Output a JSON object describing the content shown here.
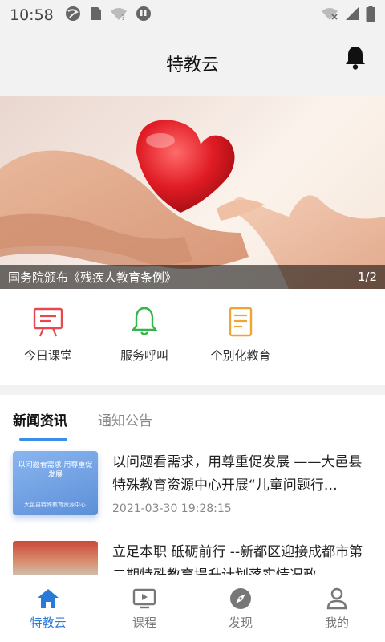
{
  "status_bar": {
    "time": "10:58",
    "icons_left": [
      "globe-icon",
      "sim-card-icon",
      "wifi-question-icon",
      "app-notification-icon"
    ],
    "icons_right": [
      "wifi-off-icon",
      "signal-icon",
      "battery-icon"
    ]
  },
  "header": {
    "title": "特教云",
    "action_icon": "bell-icon"
  },
  "banner": {
    "caption": "国务院颁布《残疾人教育条例》",
    "pager": "1/2"
  },
  "quick_actions": [
    {
      "label": "今日课堂",
      "icon": "presentation-board-icon",
      "color": "#e5484d"
    },
    {
      "label": "服务呼叫",
      "icon": "bell-outline-icon",
      "color": "#35b44a"
    },
    {
      "label": "个别化教育",
      "icon": "document-icon",
      "color": "#f0a531"
    }
  ],
  "news_tabs": [
    {
      "label": "新闻资讯",
      "active": true
    },
    {
      "label": "通知公告",
      "active": false
    }
  ],
  "news": [
    {
      "title": "以问题看需求，用尊重促发展 ——大邑县特殊教育资源中心开展“儿童问题行…",
      "time": "2021-03-30 19:28:15",
      "thumb_text": "以问题看需求 用尊重促发展",
      "thumb_subtext": "大邑县特殊教育资源中心"
    },
    {
      "title": "立足本职 砥砺前行 --新都区迎接成都市第二期特殊教育提升计划落实情况政…",
      "time": ""
    }
  ],
  "bottom_nav": [
    {
      "label": "特教云",
      "icon": "home-icon",
      "active": true
    },
    {
      "label": "课程",
      "icon": "video-screen-icon",
      "active": false
    },
    {
      "label": "发现",
      "icon": "compass-icon",
      "active": false
    },
    {
      "label": "我的",
      "icon": "user-icon",
      "active": false
    }
  ],
  "colors": {
    "accent": "#2a7ad8",
    "tab_underline": "#3a8ee6",
    "background_gray": "#f2f2f2"
  }
}
